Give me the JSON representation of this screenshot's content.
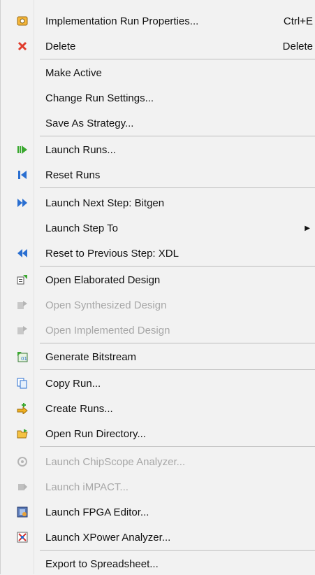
{
  "menu": {
    "items": [
      {
        "label": "Implementation Run Properties...",
        "shortcut": "Ctrl+E",
        "icon": "properties-icon"
      },
      {
        "label": "Delete",
        "shortcut": "Delete",
        "icon": "delete-x-icon"
      },
      {
        "label": "Make Active"
      },
      {
        "label": "Change Run Settings..."
      },
      {
        "label": "Save As Strategy..."
      },
      {
        "label": "Launch Runs...",
        "icon": "launch-runs-icon"
      },
      {
        "label": "Reset Runs",
        "icon": "reset-runs-icon"
      },
      {
        "label": "Launch Next Step: Bitgen",
        "icon": "launch-next-step-icon"
      },
      {
        "label": "Launch Step To",
        "submenu": true
      },
      {
        "label": "Reset to Previous Step: XDL",
        "icon": "reset-previous-step-icon"
      },
      {
        "label": "Open Elaborated Design",
        "icon": "open-elaborated-design-icon"
      },
      {
        "label": "Open Synthesized Design",
        "icon": "open-synthesized-design-icon",
        "disabled": true
      },
      {
        "label": "Open Implemented Design",
        "icon": "open-implemented-design-icon",
        "disabled": true
      },
      {
        "label": "Generate Bitstream",
        "icon": "generate-bitstream-icon"
      },
      {
        "label": "Copy Run...",
        "icon": "copy-run-icon"
      },
      {
        "label": "Create Runs...",
        "icon": "create-runs-icon"
      },
      {
        "label": "Open Run Directory...",
        "icon": "open-folder-icon"
      },
      {
        "label": "Launch ChipScope Analyzer...",
        "icon": "chipscope-icon",
        "disabled": true
      },
      {
        "label": "Launch iMPACT...",
        "icon": "impact-icon",
        "disabled": true
      },
      {
        "label": "Launch FPGA Editor...",
        "icon": "fpga-editor-icon"
      },
      {
        "label": "Launch XPower Analyzer...",
        "icon": "xpower-icon"
      },
      {
        "label": "Export to Spreadsheet..."
      }
    ]
  },
  "colors": {
    "accent_blue": "#2a6fd1",
    "delete_red": "#e03c2c",
    "launch_green": "#3aa830",
    "disabled_gray": "#a7a7a7"
  }
}
